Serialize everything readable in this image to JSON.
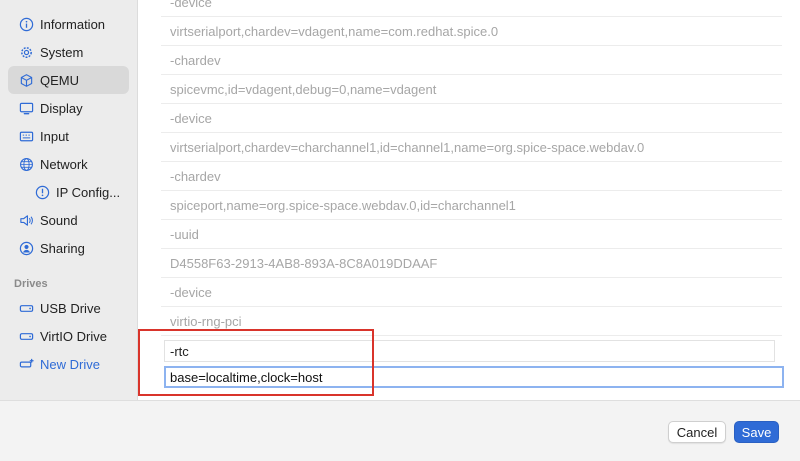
{
  "sidebar": {
    "items": [
      {
        "label": "Information",
        "icon": "info-circle-icon"
      },
      {
        "label": "System",
        "icon": "gear-icon"
      },
      {
        "label": "QEMU",
        "icon": "cube-icon"
      },
      {
        "label": "Display",
        "icon": "display-icon"
      },
      {
        "label": "Input",
        "icon": "keyboard-icon"
      },
      {
        "label": "Network",
        "icon": "globe-icon"
      },
      {
        "label": "IP Config...",
        "icon": "info-circle-icon"
      },
      {
        "label": "Sound",
        "icon": "speaker-icon"
      },
      {
        "label": "Sharing",
        "icon": "person-circle-icon"
      }
    ],
    "drives_title": "Drives",
    "drives": [
      {
        "label": "USB Drive",
        "icon": "drive-icon"
      },
      {
        "label": "VirtIO Drive",
        "icon": "drive-icon"
      },
      {
        "label": "New Drive",
        "icon": "add-drive-icon"
      }
    ],
    "active_item": "QEMU",
    "accent_color": "#2f6bd6"
  },
  "arguments": {
    "rows": [
      "-device",
      "virtserialport,chardev=vdagent,name=com.redhat.spice.0",
      "-chardev",
      "spicevmc,id=vdagent,debug=0,name=vdagent",
      "-device",
      "virtserialport,chardev=charchannel1,id=channel1,name=org.spice-space.webdav.0",
      "-chardev",
      "spiceport,name=org.spice-space.webdav.0,id=charchannel1",
      "-uuid",
      "D4558F63-2913-4AB8-893A-8C8A019DDAAF",
      "-device",
      "virtio-rng-pci"
    ],
    "editable_rows": [
      "-rtc",
      "base=localtime,clock=host"
    ]
  },
  "footer": {
    "cancel_label": "Cancel",
    "save_label": "Save"
  }
}
